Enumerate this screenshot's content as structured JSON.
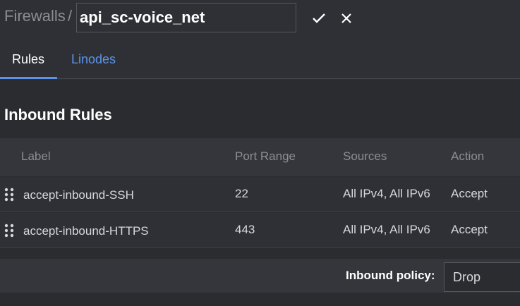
{
  "breadcrumb": {
    "parent": "Firewalls",
    "separator": "/"
  },
  "firewall": {
    "name_value": "api_sc-voice_net"
  },
  "icons": {
    "confirm": "check-icon",
    "cancel": "close-icon",
    "drag": "drag-handle-icon"
  },
  "tabs": [
    {
      "label": "Rules",
      "active": true
    },
    {
      "label": "Linodes",
      "active": false
    }
  ],
  "inbound": {
    "title": "Inbound Rules",
    "columns": [
      "Label",
      "Port Range",
      "Sources",
      "Action"
    ],
    "rows": [
      {
        "label": "accept-inbound-SSH",
        "port_range": "22",
        "sources": "All IPv4, All IPv6",
        "action": "Accept"
      },
      {
        "label": "accept-inbound-HTTPS",
        "port_range": "443",
        "sources": "All IPv4, All IPv6",
        "action": "Accept"
      }
    ],
    "policy_label": "Inbound policy:",
    "policy_value": "Drop"
  },
  "colors": {
    "accent": "#5c93ea",
    "background": "#2e3035"
  }
}
